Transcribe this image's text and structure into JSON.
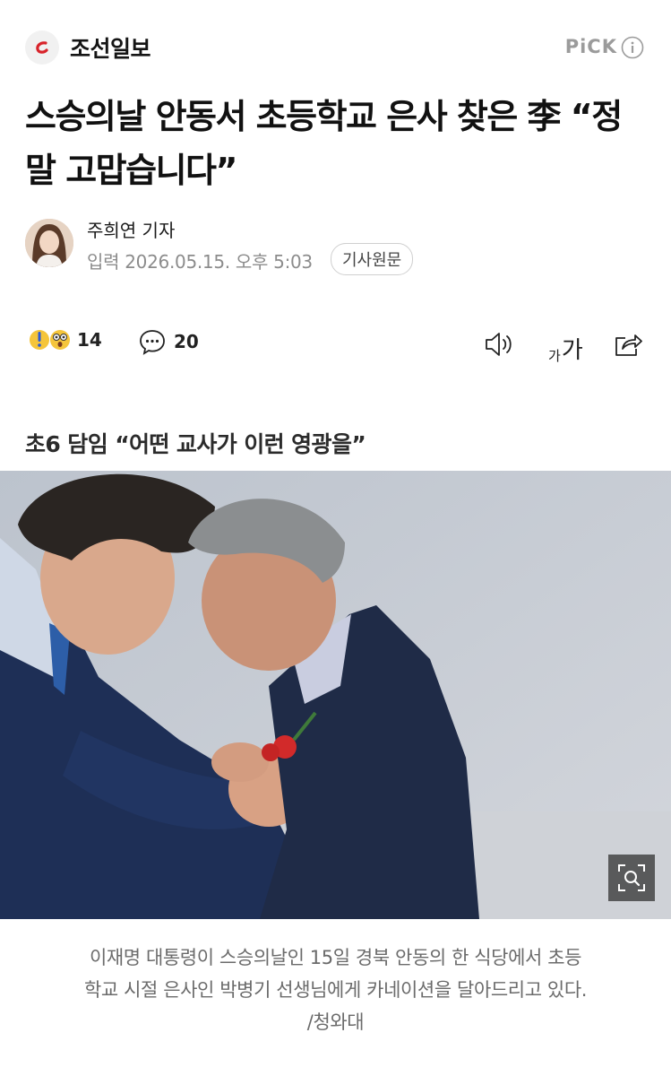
{
  "header": {
    "publisher": "조선일보",
    "pick_label": "PiCK"
  },
  "article": {
    "headline": "스승의날 안동서 초등학교 은사 찾은 李 “정말 고맙습니다”",
    "reporter": "주희연 기자",
    "date": "입력 2026.05.15. 오후 5:03",
    "original_button": "기사원문",
    "subtitle": "초6 담임 “어떤 교사가 이런 영광을”",
    "caption_line1": "이재명 대통령이 스승의날인 15일 경북 안동의 한 식당에서 초등",
    "caption_line2": "학교 시절 은사인 박병기 선생님에게 카네이션을 달아드리고 있다.",
    "caption_line3": "/청와대"
  },
  "toolbar": {
    "reaction_count": "14",
    "comment_count": "20",
    "font_small": "가",
    "font_large": "가"
  },
  "icons": [
    "chosun-logo-icon",
    "info-icon",
    "reaction-emoji-icon",
    "comment-icon",
    "speaker-icon",
    "font-size-icon",
    "share-icon",
    "zoom-icon"
  ],
  "colors": {
    "brand_red": "#d8232a",
    "pick_gray": "#9b9b9b",
    "caption_gray": "#6b6b6b"
  }
}
